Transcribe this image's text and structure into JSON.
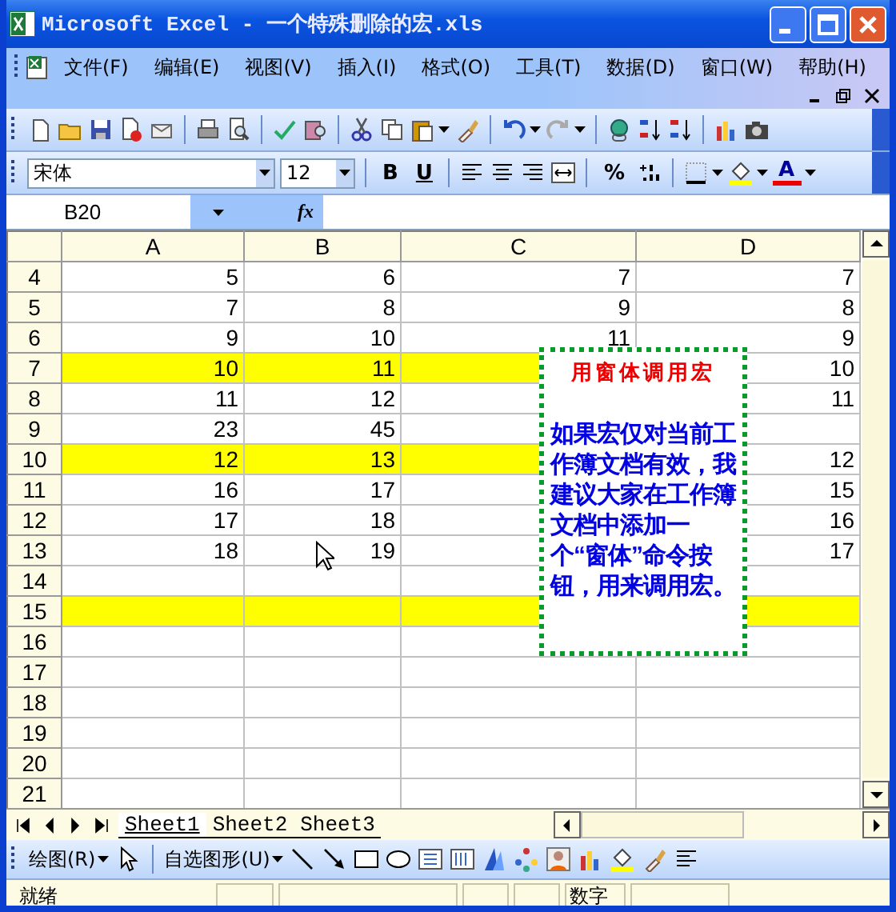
{
  "window": {
    "title": "Microsoft Excel - 一个特殊删除的宏.xls"
  },
  "menu_bar": {
    "items": [
      "文件(F)",
      "编辑(E)",
      "视图(V)",
      "插入(I)",
      "格式(O)",
      "工具(T)",
      "数据(D)",
      "窗口(W)",
      "帮助(H)"
    ]
  },
  "format_toolbar": {
    "font": "宋体",
    "size": "12",
    "bold": "B",
    "underline": "U",
    "percent": "%",
    "font_color": "A"
  },
  "formula_bar": {
    "name_box": "B20",
    "fx": "fx"
  },
  "sheet": {
    "columns": [
      "A",
      "B",
      "C",
      "D"
    ],
    "rows": [
      {
        "number": "4",
        "cells": [
          {
            "value": "5",
            "highlighted": false
          },
          {
            "value": "6",
            "highlighted": false
          },
          {
            "value": "7",
            "highlighted": false
          },
          {
            "value": "7",
            "highlighted": false
          }
        ]
      },
      {
        "number": "5",
        "cells": [
          {
            "value": "7",
            "highlighted": false
          },
          {
            "value": "8",
            "highlighted": false
          },
          {
            "value": "9",
            "highlighted": false
          },
          {
            "value": "8",
            "highlighted": false
          }
        ]
      },
      {
        "number": "6",
        "cells": [
          {
            "value": "9",
            "highlighted": false
          },
          {
            "value": "10",
            "highlighted": false
          },
          {
            "value": "11",
            "highlighted": false
          },
          {
            "value": "9",
            "highlighted": false
          }
        ]
      },
      {
        "number": "7",
        "cells": [
          {
            "value": "10",
            "highlighted": true
          },
          {
            "value": "11",
            "highlighted": true
          },
          {
            "highlighted": true
          },
          {
            "value": "10",
            "highlighted": false
          }
        ]
      },
      {
        "number": "8",
        "cells": [
          {
            "value": "11",
            "highlighted": false
          },
          {
            "value": "12",
            "highlighted": false
          },
          {
            "highlighted": false
          },
          {
            "value": "11",
            "highlighted": false
          }
        ]
      },
      {
        "number": "9",
        "cells": [
          {
            "value": "23",
            "highlighted": false
          },
          {
            "value": "45",
            "highlighted": false
          },
          {
            "highlighted": false
          },
          {
            "highlighted": false
          }
        ]
      },
      {
        "number": "10",
        "cells": [
          {
            "value": "12",
            "highlighted": true
          },
          {
            "value": "13",
            "highlighted": true
          },
          {
            "highlighted": true
          },
          {
            "value": "12",
            "highlighted": false
          }
        ]
      },
      {
        "number": "11",
        "cells": [
          {
            "value": "16",
            "highlighted": false
          },
          {
            "value": "17",
            "highlighted": false
          },
          {
            "highlighted": false
          },
          {
            "value": "15",
            "highlighted": false
          }
        ]
      },
      {
        "number": "12",
        "cells": [
          {
            "value": "17",
            "highlighted": false
          },
          {
            "value": "18",
            "highlighted": false
          },
          {
            "highlighted": false
          },
          {
            "value": "16",
            "highlighted": false
          }
        ]
      },
      {
        "number": "13",
        "cells": [
          {
            "value": "18",
            "highlighted": false
          },
          {
            "value": "19",
            "highlighted": false
          },
          {
            "highlighted": false
          },
          {
            "value": "17",
            "highlighted": false
          }
        ]
      },
      {
        "number": "14",
        "cells": [
          {
            "highlighted": false
          },
          {
            "highlighted": false
          },
          {
            "highlighted": false
          },
          {
            "highlighted": false
          }
        ]
      },
      {
        "number": "15",
        "cells": [
          {
            "highlighted": true
          },
          {
            "highlighted": true
          },
          {
            "highlighted": true
          },
          {
            "highlighted": true
          }
        ]
      },
      {
        "number": "16",
        "cells": [
          {
            "highlighted": false
          },
          {
            "highlighted": false
          },
          {
            "highlighted": false
          },
          {
            "highlighted": false
          }
        ]
      },
      {
        "number": "17",
        "cells": [
          {
            "highlighted": false
          },
          {
            "highlighted": false
          },
          {
            "highlighted": false
          },
          {
            "highlighted": false
          }
        ]
      },
      {
        "number": "18",
        "cells": [
          {
            "highlighted": false
          },
          {
            "highlighted": false
          },
          {
            "highlighted": false
          },
          {
            "highlighted": false
          }
        ]
      },
      {
        "number": "19",
        "cells": [
          {
            "highlighted": false
          },
          {
            "highlighted": false
          },
          {
            "highlighted": false
          },
          {
            "highlighted": false
          }
        ]
      },
      {
        "number": "20",
        "cells": [
          {
            "highlighted": false
          },
          {
            "highlighted": false
          },
          {
            "highlighted": false
          },
          {
            "highlighted": false
          }
        ]
      },
      {
        "number": "21",
        "cells": [
          {
            "highlighted": false
          },
          {
            "highlighted": false
          },
          {
            "highlighted": false
          },
          {
            "highlighted": false
          }
        ]
      }
    ]
  },
  "text_box": {
    "title": "用窗体调用宏",
    "body": "如果宏仅对当前工作簿文档有效，我建议大家在工作簿文档中添加一个“窗体”命令按钮，用来调用宏。"
  },
  "sheet_tabs": [
    {
      "label": "Sheet1",
      "selected": true
    },
    {
      "label": "Sheet2",
      "selected": false
    },
    {
      "label": "Sheet3",
      "selected": false
    }
  ],
  "drawing_toolbar": {
    "draw": "绘图(R)",
    "autoshapes": "自选图形(U)"
  },
  "status_bar": {
    "status": "就绪",
    "indicator": "数字"
  }
}
